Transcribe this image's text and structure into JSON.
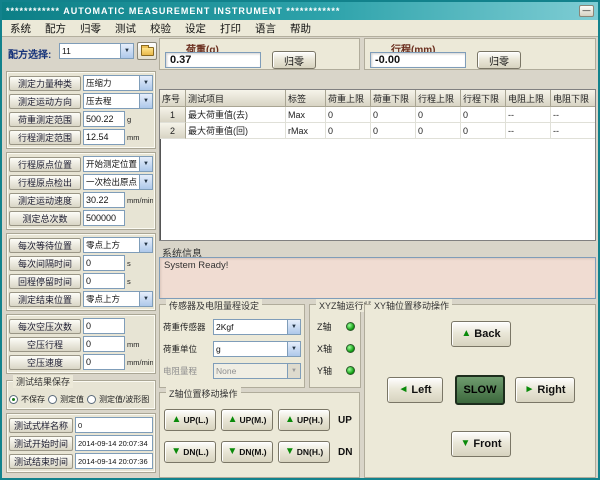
{
  "window": {
    "title": "************  AUTOMATIC MEASUREMENT INSTRUMENT  ************",
    "minimize_glyph": "—"
  },
  "menu": {
    "items": [
      "系统",
      "配方",
      "归零",
      "测试",
      "校验",
      "设定",
      "打印",
      "语言",
      "帮助"
    ]
  },
  "recipe": {
    "label": "配方选择:",
    "value": "11"
  },
  "load_panel": {
    "title": "荷重(g)",
    "value": "0.37",
    "zero_label": "归零"
  },
  "stroke_panel": {
    "title": "行程(mm)",
    "value": "-0.00",
    "zero_label": "归零"
  },
  "settings_sections": [
    {
      "rows": [
        {
          "label": "测定力量种类",
          "type": "select",
          "value": "压缩力",
          "unit": ""
        },
        {
          "label": "测定运动方向",
          "type": "select",
          "value": "压去程",
          "unit": ""
        },
        {
          "label": "荷重测定范围",
          "type": "input",
          "value": "500.22",
          "unit": "g"
        },
        {
          "label": "行程测定范围",
          "type": "input",
          "value": "12.54",
          "unit": "mm"
        }
      ]
    },
    {
      "rows": [
        {
          "label": "行程原点位置",
          "type": "select",
          "value": "开始测定位置",
          "unit": ""
        },
        {
          "label": "行程原点检出",
          "type": "select",
          "value": "一次检出原点",
          "unit": ""
        },
        {
          "label": "测定运动速度",
          "type": "input",
          "value": "30.22",
          "unit": "mm/min"
        },
        {
          "label": "测定总次数",
          "type": "input",
          "value": "500000",
          "unit": ""
        }
      ]
    },
    {
      "rows": [
        {
          "label": "每次等待位置",
          "type": "select",
          "value": "零点上方",
          "unit": ""
        },
        {
          "label": "每次间隔时间",
          "type": "input",
          "value": "0",
          "unit": "s"
        },
        {
          "label": "回程停留时间",
          "type": "input",
          "value": "0",
          "unit": "s"
        },
        {
          "label": "测定结束位置",
          "type": "select",
          "value": "零点上方",
          "unit": ""
        }
      ]
    },
    {
      "rows": [
        {
          "label": "每次空压次数",
          "type": "input",
          "value": "0",
          "unit": ""
        },
        {
          "label": "空压行程",
          "type": "input",
          "value": "0",
          "unit": "mm"
        },
        {
          "label": "空压速度",
          "type": "input",
          "value": "0",
          "unit": "mm/min"
        }
      ]
    }
  ],
  "save_group": {
    "title": "测试结果保存",
    "options": [
      {
        "label": "不保存",
        "selected": true
      },
      {
        "label": "测定值",
        "selected": false
      },
      {
        "label": "测定值/波形图",
        "selected": false
      }
    ]
  },
  "result_section": {
    "rows": [
      {
        "label": "测试式样名称",
        "value": "0"
      },
      {
        "label": "测试开始时间",
        "value": "2014-09-14 20:07:34"
      },
      {
        "label": "测试结束时间",
        "value": "2014-09-14 20:07:36"
      }
    ]
  },
  "table": {
    "columns": [
      "序号",
      "测试项目",
      "标签",
      "荷重上限",
      "荷重下限",
      "行程上限",
      "行程下限",
      "电阻上限",
      "电阻下限"
    ],
    "rows": [
      [
        "1",
        "最大荷重值(去)",
        "Max",
        "0",
        "0",
        "0",
        "0",
        "--",
        "--"
      ],
      [
        "2",
        "最大荷重值(回)",
        "rMax",
        "0",
        "0",
        "0",
        "0",
        "--",
        "--"
      ]
    ]
  },
  "system_info": {
    "label": "系统信息",
    "message": "System Ready!"
  },
  "sensor_group": {
    "title": "传感器及电阻量程设定",
    "rows": [
      {
        "label": "荷重传感器",
        "value": "2Kgf",
        "disabled": false
      },
      {
        "label": "荷重单位",
        "value": "g",
        "disabled": false
      },
      {
        "label": "电阻量程",
        "value": "None",
        "disabled": true
      }
    ]
  },
  "xyz_status": {
    "title": "XYZ轴运行状态",
    "axes": [
      {
        "label": "Z轴"
      },
      {
        "label": "X轴"
      },
      {
        "label": "Y轴"
      }
    ]
  },
  "z_move": {
    "title": "Z轴位置移动操作",
    "up_row": {
      "buttons": [
        "UP(L.)",
        "UP(M.)",
        "UP(H.)"
      ],
      "tag": "UP"
    },
    "dn_row": {
      "buttons": [
        "DN(L.)",
        "DN(M.)",
        "DN(H.)"
      ],
      "tag": "DN"
    }
  },
  "xy_move": {
    "title": "XY轴位置移动操作",
    "back": "Back",
    "left": "Left",
    "slow": "SLOW",
    "right": "Right",
    "front": "Front"
  }
}
